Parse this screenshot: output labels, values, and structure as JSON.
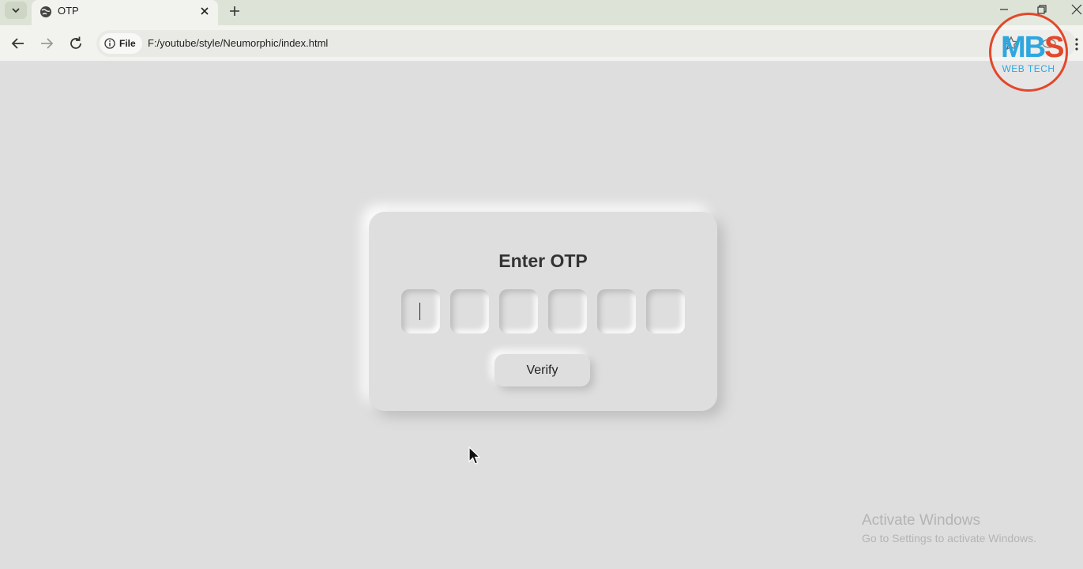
{
  "browser": {
    "tab_title": "OTP",
    "site_chip_label": "File",
    "url": "F:/youtube/style/Neumorphic/index.html"
  },
  "logo": {
    "mark_m_b": "MB",
    "mark_s": "S",
    "subtitle": "WEB TECH"
  },
  "card": {
    "title": "Enter OTP",
    "otp_values": [
      "",
      "",
      "",
      "",
      "",
      ""
    ],
    "verify_label": "Verify"
  },
  "watermark": {
    "title": "Activate Windows",
    "subtitle": "Go to Settings to activate Windows."
  },
  "colors": {
    "background": "#dedede",
    "logo_blue": "#2ea7e0",
    "logo_red": "#e4472a"
  }
}
